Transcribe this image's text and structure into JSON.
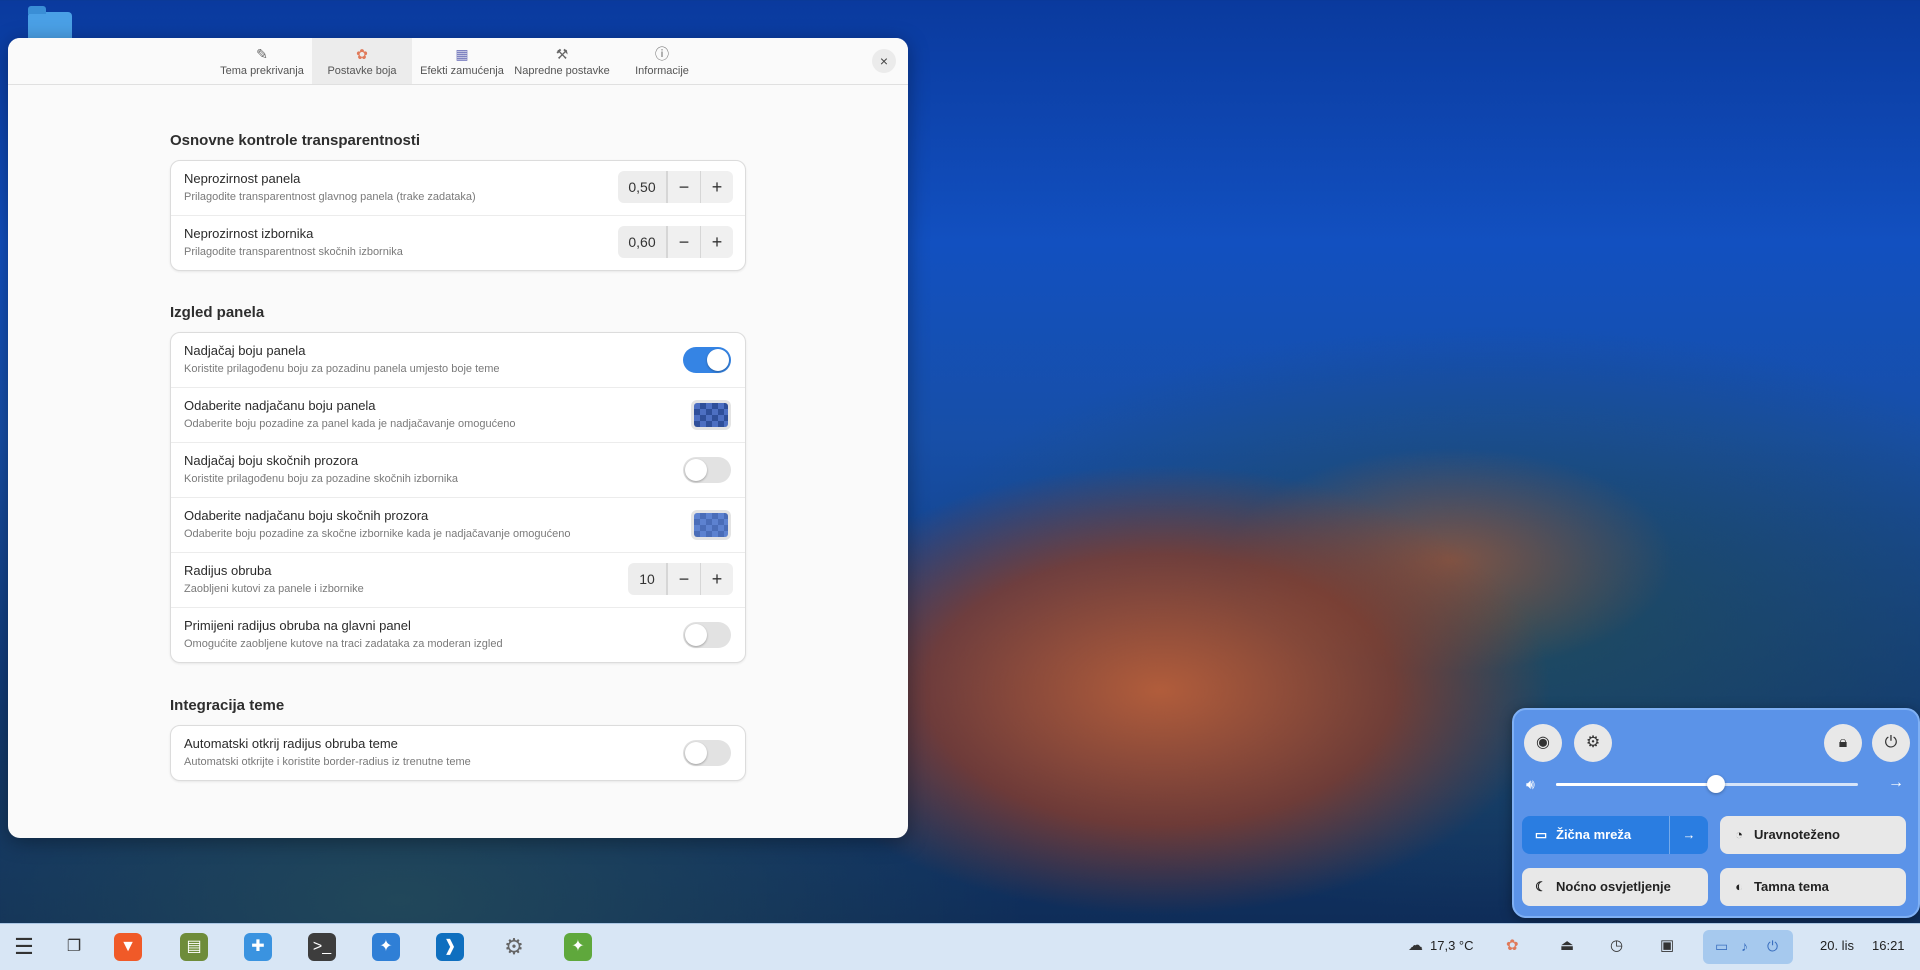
{
  "window": {
    "tabs": [
      {
        "label": "Tema prekrivanja",
        "icon": "palette-icon"
      },
      {
        "label": "Postavke boja",
        "icon": "color-icon"
      },
      {
        "label": "Efekti zamućenja",
        "icon": "blur-icon"
      },
      {
        "label": "Napredne postavke",
        "icon": "tools-icon"
      },
      {
        "label": "Informacije",
        "icon": "info-icon"
      }
    ],
    "active_tab": "Postavke boja",
    "close_icon": "×",
    "sections": {
      "transparency": {
        "title": "Osnovne kontrole transparentnosti",
        "rows": [
          {
            "title": "Neprozirnost panela",
            "subtitle": "Prilagodite transparentnost glavnog panela (trake zadataka)",
            "value": "0,50"
          },
          {
            "title": "Neprozirnost izbornika",
            "subtitle": "Prilagodite transparentnost skočnih izbornika",
            "value": "0,60"
          }
        ]
      },
      "panel": {
        "title": "Izgled panela",
        "rows": [
          {
            "title": "Nadjačaj boju panela",
            "subtitle": "Koristite prilagođenu boju za pozadinu panela umjesto boje teme",
            "state": "on"
          },
          {
            "title": "Odaberite nadjačanu boju panela",
            "subtitle": "Odaberite boju pozadine za panel kada je nadjačavanje omogućeno"
          },
          {
            "title": "Nadjačaj boju skočnih prozora",
            "subtitle": "Koristite prilagođenu boju za pozadine skočnih izbornika",
            "state": "off"
          },
          {
            "title": "Odaberite nadjačanu boju skočnih prozora",
            "subtitle": "Odaberite boju pozadine za skočne izbornike kada je nadjačavanje omogućeno"
          },
          {
            "title": "Radijus obruba",
            "subtitle": "Zaobljeni kutovi za panele i izbornike",
            "value": "10"
          },
          {
            "title": "Primijeni radijus obruba na glavni panel",
            "subtitle": "Omogućite zaobljene kutove na traci zadataka za moderan izgled",
            "state": "off"
          }
        ]
      },
      "theme": {
        "title": "Integracija teme",
        "rows": [
          {
            "title": "Automatski otkrij radijus obruba teme",
            "subtitle": "Automatski otkrijte i koristite border-radius iz trenutne teme",
            "state": "off"
          }
        ]
      }
    },
    "spin_minus": "−",
    "spin_plus": "+"
  },
  "quick_settings": {
    "volume_level": 0.53,
    "wired_label": "Žična mreža",
    "power_label": "Uravnoteženo",
    "night_label": "Noćno osvjetljenje",
    "dark_label": "Tamna tema"
  },
  "taskbar": {
    "weather": "17,3 °C",
    "clock_date": "20. lis",
    "clock_time": "16:21"
  },
  "colors": {
    "accent": "#3584e4",
    "quick_settings_bg": "#5b93e8",
    "taskbar_bg": "#d8e6f5"
  }
}
